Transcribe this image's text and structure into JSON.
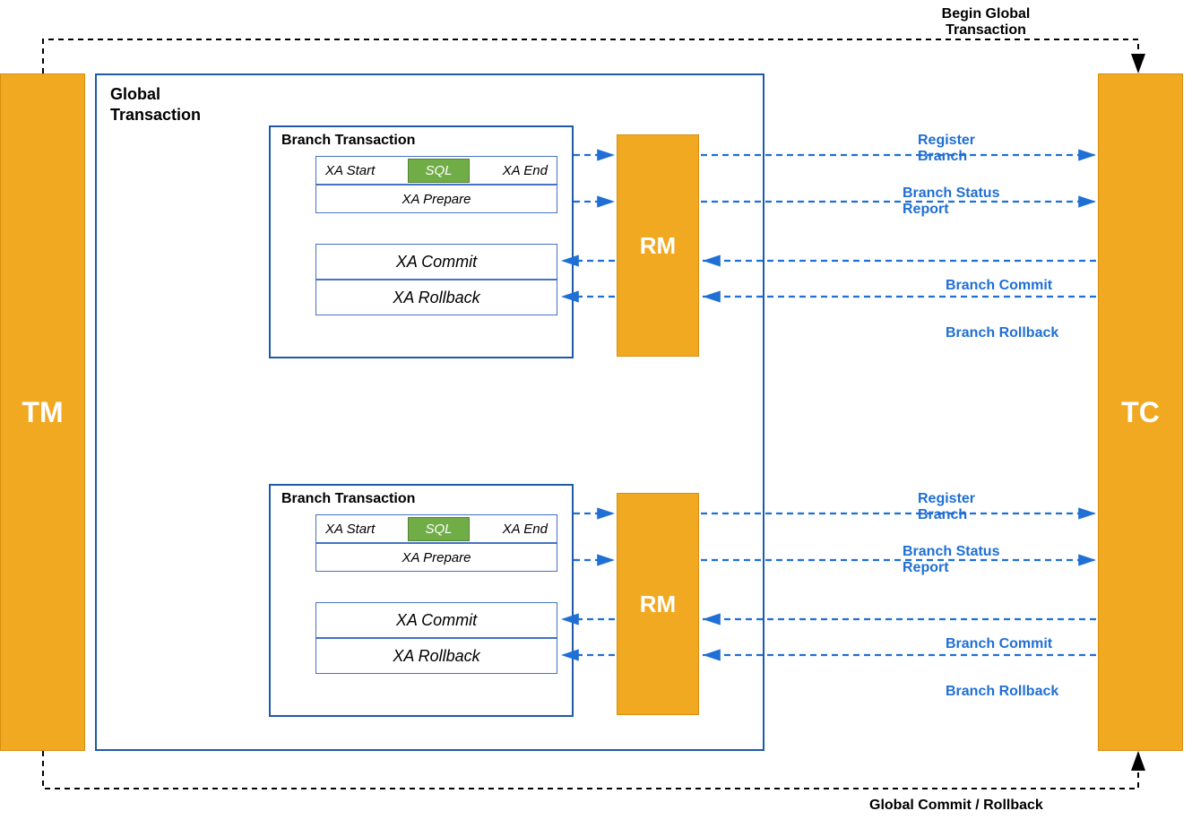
{
  "tm": {
    "label": "TM"
  },
  "tc": {
    "label": "TC"
  },
  "global": {
    "title": "Global\nTransaction"
  },
  "branch": {
    "title": "Branch Transaction",
    "xa_start": "XA Start",
    "sql": "SQL",
    "xa_end": "XA End",
    "xa_prepare": "XA Prepare",
    "xa_commit": "XA Commit",
    "xa_rollback": "XA Rollback"
  },
  "rm": {
    "label": "RM"
  },
  "messages": {
    "register_branch": "Register\nBranch",
    "branch_status_report": "Branch Status\nReport",
    "branch_commit": "Branch Commit",
    "branch_rollback": "Branch Rollback",
    "begin_global": "Begin Global\nTransaction",
    "global_commit_rollback": "Global Commit / Rollback"
  },
  "colors": {
    "accent_blue": "#1f6fd4",
    "box_blue": "#1f5aa6",
    "orange": "#f2a922",
    "green": "#70ad47"
  }
}
